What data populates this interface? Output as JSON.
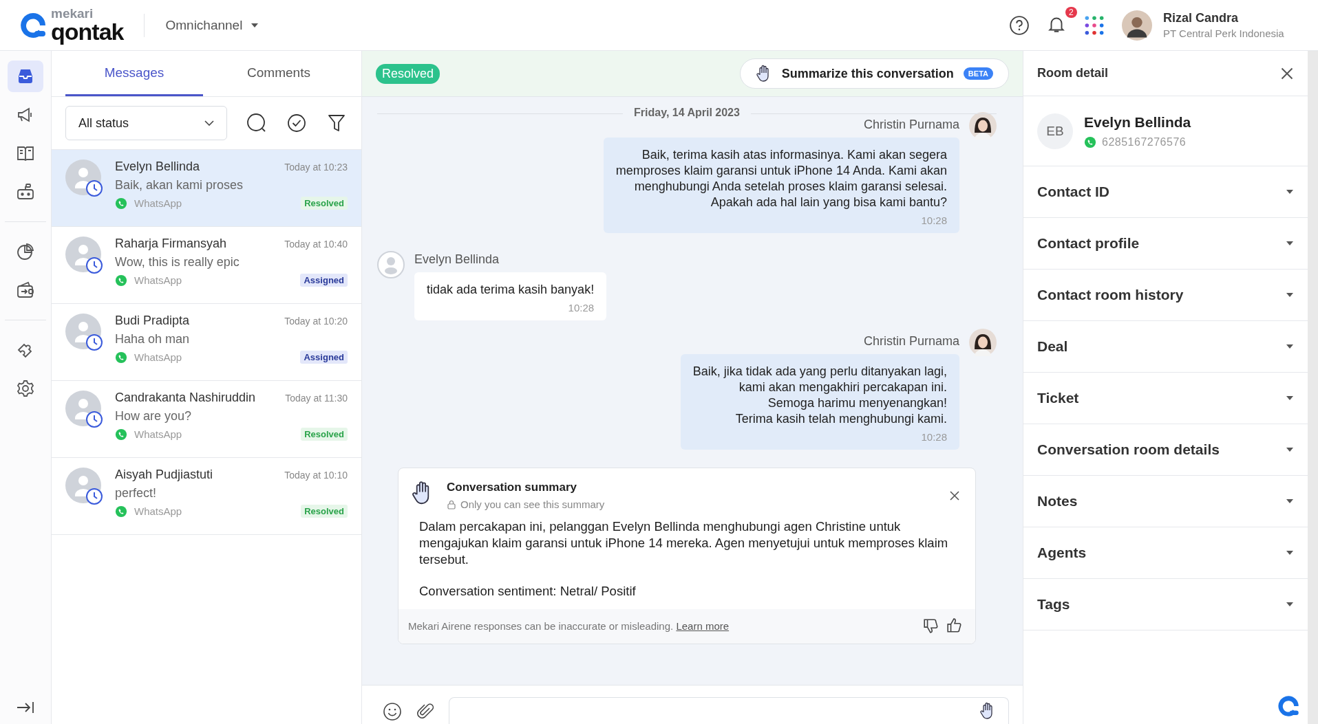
{
  "header": {
    "brand_top": "mekari",
    "brand": "qontak",
    "product_switcher": "Omnichannel",
    "notification_count": "2",
    "user": {
      "name": "Rizal Candra",
      "company": "PT Central Perk Indonesia"
    }
  },
  "nav_rail": {
    "groups": [
      [
        {
          "kind": "inbox",
          "selected": true
        },
        {
          "kind": "broadcast",
          "selected": false
        },
        {
          "kind": "book",
          "selected": false
        },
        {
          "kind": "bot",
          "selected": false
        }
      ],
      [
        {
          "kind": "chart",
          "selected": false
        },
        {
          "kind": "wallet",
          "selected": false
        }
      ],
      [
        {
          "kind": "puzzle",
          "selected": false
        },
        {
          "kind": "settings",
          "selected": false
        }
      ]
    ]
  },
  "conversation_list": {
    "tabs": [
      {
        "label": "Messages",
        "selected": true
      },
      {
        "label": "Comments",
        "selected": false
      }
    ],
    "status_filter": "All status",
    "conversations": [
      {
        "name": "Evelyn Bellinda",
        "time": "Today at 10:23",
        "preview": "Baik, akan kami proses",
        "channel": "WhatsApp",
        "status": "Resolved",
        "kind": "resolved",
        "selected": true
      },
      {
        "name": "Raharja Firmansyah",
        "time": "Today at 10:40",
        "preview": "Wow, this is really epic",
        "channel": "WhatsApp",
        "status": "Assigned",
        "kind": "assigned",
        "selected": false
      },
      {
        "name": "Budi Pradipta",
        "time": "Today at 10:20",
        "preview": "Haha oh man",
        "channel": "WhatsApp",
        "status": "Assigned",
        "kind": "assigned",
        "selected": false
      },
      {
        "name": "Candrakanta Nashiruddin",
        "time": "Today at 11:30",
        "preview": "How are you?",
        "channel": "WhatsApp",
        "status": "Resolved",
        "kind": "resolved",
        "selected": false
      },
      {
        "name": "Aisyah Pudjiastuti",
        "time": "Today at 10:10",
        "preview": "perfect!",
        "channel": "WhatsApp",
        "status": "Resolved",
        "kind": "resolved",
        "selected": false
      }
    ]
  },
  "chat": {
    "status_badge": "Resolved",
    "summarize_button": {
      "label": "Summarize this conversation",
      "badge": "BETA"
    },
    "date": "Friday, 14 April 2023",
    "messages": [
      {
        "kind": "outgoing",
        "sender": "Christin Purnama",
        "text": "Baik, terima kasih atas informasinya. Kami akan segera\nmemproses klaim garansi untuk iPhone 14 Anda. Kami akan\nmenghubungi Anda setelah proses klaim garansi selesai.\nApakah ada hal lain yang bisa kami bantu?",
        "time": "10:28"
      },
      {
        "kind": "incoming",
        "sender": "Evelyn Bellinda",
        "text": "tidak ada terima kasih banyak!",
        "time": "10:28"
      },
      {
        "kind": "outgoing",
        "sender": "Christin Purnama",
        "text": "Baik, jika tidak ada yang perlu ditanyakan lagi,\nkami akan mengakhiri percakapan ini.\nSemoga harimu menyenangkan!\nTerima kasih telah menghubungi kami.",
        "time": "10:28"
      }
    ],
    "summary": {
      "title": "Conversation summary",
      "note": "Only you can see this summary",
      "body": "Dalam percakapan ini, pelanggan Evelyn Bellinda menghubungi agen Christine untuk mengajukan klaim garansi untuk iPhone 14 mereka. Agen menyetujui untuk memproses klaim tersebut.",
      "sentiment": "Conversation sentiment: Netral/ Positif",
      "disclaimer": "Mekari Airene responses can be inaccurate or misleading.",
      "link": "Learn more"
    }
  },
  "room_detail": {
    "title": "Room detail",
    "contact": {
      "initials": "EB",
      "name": "Evelyn Bellinda",
      "phone": "6285167276576"
    },
    "sections": [
      {
        "label": "Contact ID",
        "expanded": false
      },
      {
        "label": "Contact profile",
        "expanded": false
      },
      {
        "label": "Contact room history",
        "expanded": false
      },
      {
        "label": "Deal",
        "expanded": false
      },
      {
        "label": "Ticket",
        "expanded": false
      },
      {
        "label": "Conversation room details",
        "expanded": false
      },
      {
        "label": "Notes",
        "expanded": false
      },
      {
        "label": "Agents",
        "expanded": false
      },
      {
        "label": "Tags",
        "expanded": false
      }
    ]
  }
}
